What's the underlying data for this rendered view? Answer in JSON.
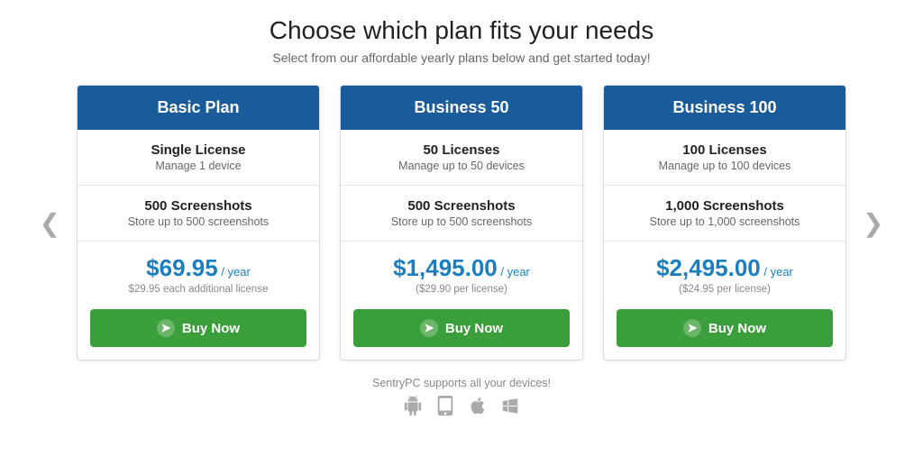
{
  "header": {
    "title": "Choose which plan fits your needs",
    "subtitle": "Select from our affordable yearly plans below and get started today!"
  },
  "nav": {
    "prev": "❮",
    "next": "❯"
  },
  "plans": [
    {
      "id": "basic",
      "name": "Basic Plan",
      "license_title": "Single License",
      "license_sub": "Manage 1 device",
      "screenshots_title": "500 Screenshots",
      "screenshots_sub": "Store up to 500 screenshots",
      "price": "$69.95",
      "period": "/ year",
      "price_note": "$29.95 each additional license",
      "buy_label": "Buy Now"
    },
    {
      "id": "business50",
      "name": "Business 50",
      "license_title": "50 Licenses",
      "license_sub": "Manage up to 50 devices",
      "screenshots_title": "500 Screenshots",
      "screenshots_sub": "Store up to 500 screenshots",
      "price": "$1,495.00",
      "period": "/ year",
      "price_note": "($29.90 per license)",
      "buy_label": "Buy Now"
    },
    {
      "id": "business100",
      "name": "Business 100",
      "license_title": "100 Licenses",
      "license_sub": "Manage up to 100 devices",
      "screenshots_title": "1,000 Screenshots",
      "screenshots_sub": "Store up to 1,000 screenshots",
      "price": "$2,495.00",
      "period": "/ year",
      "price_note": "($24.95 per license)",
      "buy_label": "Buy Now"
    }
  ],
  "footer": {
    "label": "SentryPC supports all your devices!",
    "devices": [
      "android",
      "android-alt",
      "apple",
      "windows"
    ]
  }
}
